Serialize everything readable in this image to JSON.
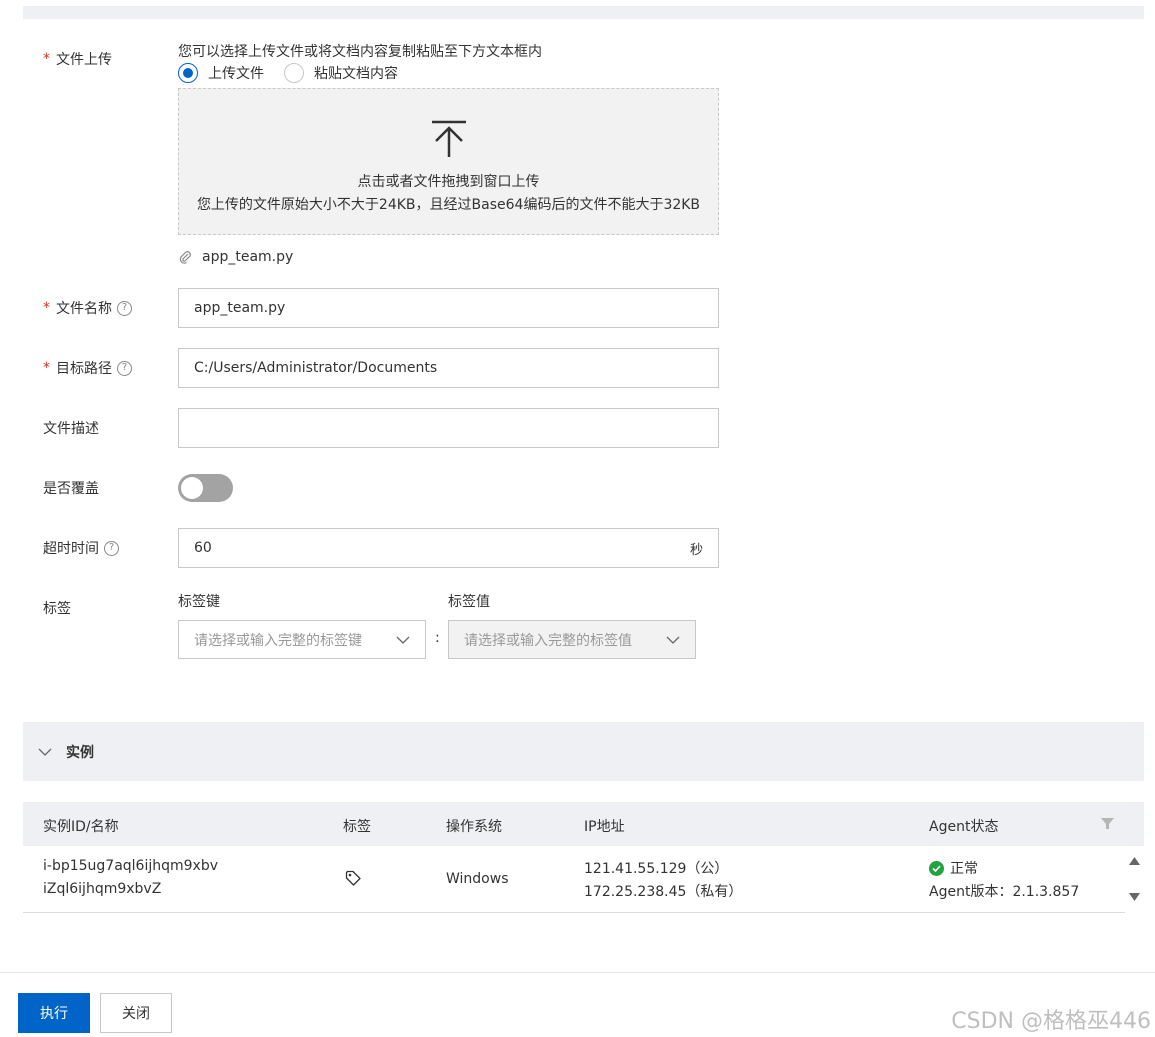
{
  "form": {
    "upload": {
      "label": "文件上传",
      "required": "*",
      "hint": "您可以选择上传文件或将文档内容复制粘贴至下方文本框内",
      "option_upload": "上传文件",
      "option_paste": "粘贴文档内容",
      "dropzone_line1": "点击或者文件拖拽到窗口上传",
      "dropzone_line2": "您上传的文件原始大小不大于24KB，且经过Base64编码后的文件不能大于32KB",
      "uploaded_file": "app_team.py"
    },
    "file_name": {
      "label": "文件名称",
      "required": "*",
      "help": "?",
      "value": "app_team.py"
    },
    "target_path": {
      "label": "目标路径",
      "required": "*",
      "help": "?",
      "value": "C:/Users/Administrator/Documents"
    },
    "description": {
      "label": "文件描述",
      "value": ""
    },
    "overwrite": {
      "label": "是否覆盖",
      "enabled": false
    },
    "timeout": {
      "label": "超时时间",
      "help": "?",
      "value": "60",
      "unit": "秒"
    },
    "tags": {
      "label": "标签",
      "key_label": "标签键",
      "value_label": "标签值",
      "key_placeholder": "请选择或输入完整的标签键",
      "value_placeholder": "请选择或输入完整的标签值",
      "separator": ":"
    }
  },
  "instances": {
    "section_title": "实例",
    "columns": {
      "id": "实例ID/名称",
      "tags": "标签",
      "os": "操作系统",
      "ip": "IP地址",
      "agent": "Agent状态"
    },
    "rows": [
      {
        "id": "i-bp15ug7aql6ijhqm9xbv",
        "name": "iZql6ijhqm9xbvZ",
        "os": "Windows",
        "ip_public": "121.41.55.129（公）",
        "ip_private": "172.25.238.45（私有）",
        "status": "正常",
        "agent_version": "Agent版本：2.1.3.857"
      }
    ]
  },
  "footer": {
    "execute": "执行",
    "close": "关闭"
  },
  "watermark": "CSDN @格格巫446",
  "colors": {
    "primary": "#0064c8",
    "required": "#d93026",
    "success": "#23a33f"
  }
}
